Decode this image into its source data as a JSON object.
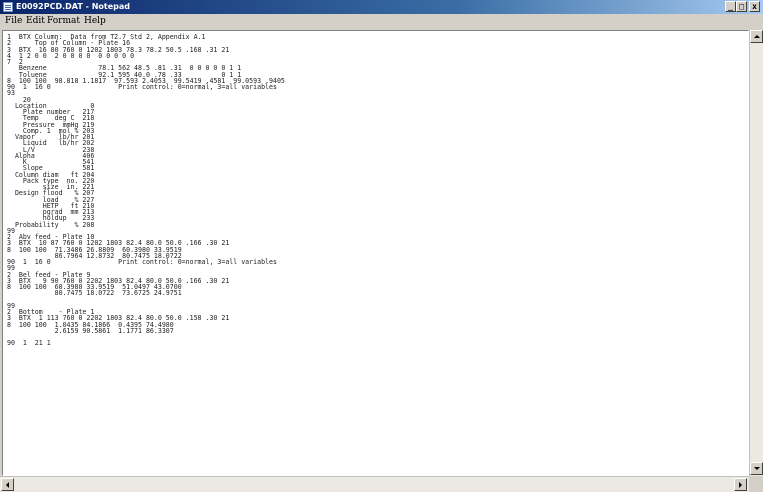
{
  "window": {
    "title": "E0092PCD.DAT - Notepad",
    "controls": {
      "minimize": "_",
      "maximize": "□",
      "close": "x"
    }
  },
  "menu": {
    "file": "File",
    "edit": "Edit",
    "format": "Format",
    "help": "Help"
  },
  "editor": {
    "text": "1  BTX Column:  Data from T2.7 Std 2, Appendix A.1\n2      Top of Column - Plate 16\n3  BTX  16 80 760 0 1202 1803 78.3 78.2 50.5 .168 .31 21\n4  1 2 0 0  2 0 0 0 0  0 0 0 0 0\n7  2\n   Benzene             78.1 562 48.5 .81 .31  0 0 0 0 0 1 1\n   Toluene             92.1 595 40.0 .78 .33          0 1 1\n8  100 100  98.818 1.1817  97.593 2.4053  99.5419 .4581  99.0593 .9405\n90  1  16 0                 Print control: 0=normal, 3=all variables\n93\n    20\n  Location           0\n    Plate number   217\n    Temp    deg C  218\n    Pressure  mmHg 219\n    Comp. 1  mol % 203\n  Vapor      lb/hr 201\n    Liquid   lb/hr 202\n    L/V            238\n  Alpha            406\n    K              541\n    Slope          581\n  Column diam   ft 204\n    Pack type  no. 220\n         size  in. 221\n  Design flood   % 207\n         load    % 227\n         HETP   ft 210\n         pgrad  mm 213\n         holdup    233\n  Probability    % 208\n99\n2  Abv feed - Plate 10\n3  BTX  10 87 760 0 1202 1803 82.4 80.0 50.0 .166 .30 21\n8  100 100  71.3486 26.8809  60.3980 33.9519\n            86.7964 12.8732  80.7475 18.0722\n90  1  16 0                 Print control: 0=normal, 3=all variables\n99\n2  Bel feed - Plate 9\n3  BTX   9 90 760 0 2202 1803 82.4 80.0 50.0 .166 .30 21\n8  100 100  60.3980 33.9519  51.0497 43.0700\n            80.7475 18.0722  73.6725 24.9751\n\n99\n2  Bottom    - Plate 1\n3  BTX  1 113 760 0 2202 1803 82.4 80.0 50.0 .158 .30 21\n8  100 100  1.0435 84.1866  0.4395 74.4980\n            2.6159 90.5861  1.1771 86.3307\n\n90  1  21 1"
  }
}
